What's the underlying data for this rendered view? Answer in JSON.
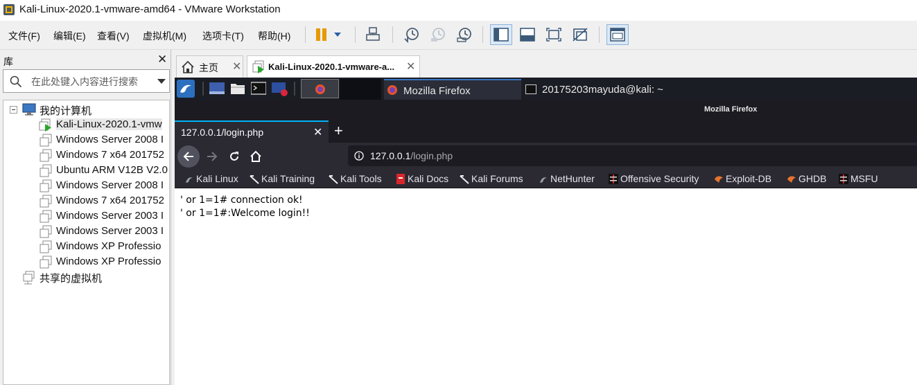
{
  "window": {
    "title": "Kali-Linux-2020.1-vmware-amd64 - VMware Workstation"
  },
  "menu": {
    "items": [
      "文件(F)",
      "编辑(E)",
      "查看(V)",
      "虚拟机(M)",
      "选项卡(T)",
      "帮助(H)"
    ]
  },
  "toolbar": {
    "buttons": [
      "pause-icon",
      "send-keys-icon",
      "snapshot-take-icon",
      "snapshot-revert-icon",
      "snapshot-manager-icon",
      "library-view-icon",
      "console-view-icon",
      "full-screen-icon",
      "unity-icon",
      "thumbnail-icon"
    ]
  },
  "library": {
    "title": "库",
    "search_placeholder": "在此处键入内容进行搜索",
    "root": "我的计算机",
    "vms": [
      "Kali-Linux-2020.1-vmw",
      "Windows Server 2008 I",
      "Windows 7 x64 201752",
      "Ubuntu ARM V12B V2.0",
      "Windows Server 2008 I",
      "Windows 7 x64 201752",
      "Windows Server 2003 I",
      "Windows Server 2003 I",
      "Windows XP Professio",
      "Windows XP Professio"
    ],
    "shared": "共享的虚拟机"
  },
  "tabs": {
    "home": "主页",
    "vm": "Kali-Linux-2020.1-vmware-a..."
  },
  "kali_panel": {
    "task1": "Mozilla Firefox",
    "task2": "20175203mayuda@kali: ~"
  },
  "firefox": {
    "window_title": "Mozilla Firefox",
    "tab_title": "127.0.0.1/login.php",
    "url_host": "127.0.0.1",
    "url_path": "/login.php",
    "bookmarks": [
      "Kali Linux",
      "Kali Training",
      "Kali Tools",
      "Kali Docs",
      "Kali Forums",
      "NetHunter",
      "Offensive Security",
      "Exploit-DB",
      "GHDB",
      "MSFU"
    ],
    "content": {
      "line1": "' or 1=1# connection ok!",
      "line2": "' or 1=1#:Welcome login!!"
    }
  },
  "colors": {
    "kali_panel": "#1b1d24",
    "firefox_chrome": "#2b2a33",
    "firefox_accent": "#00b3f4"
  }
}
